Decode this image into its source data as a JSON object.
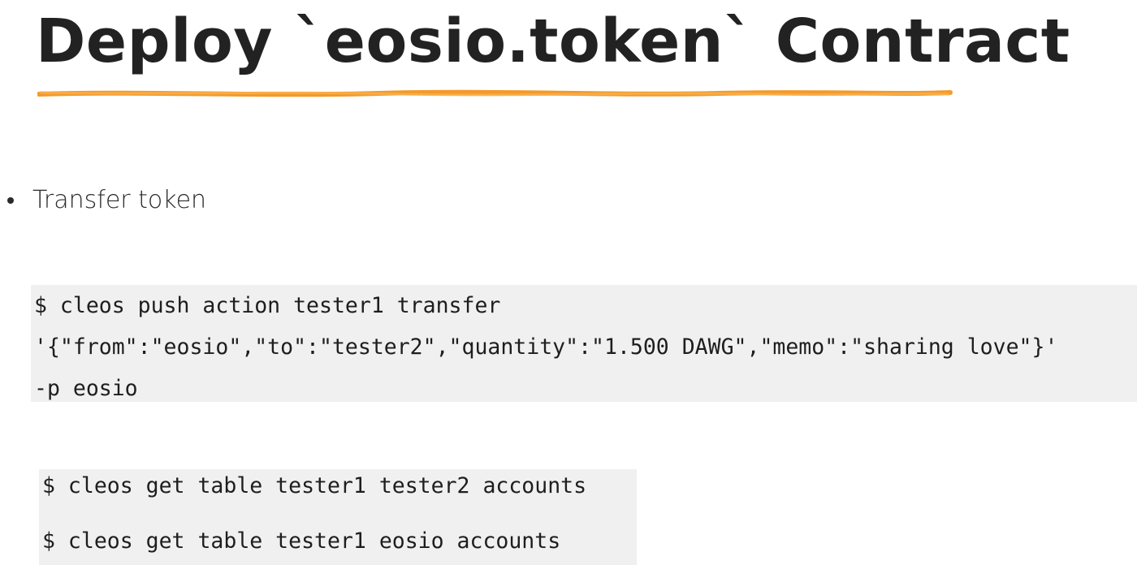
{
  "slide": {
    "title": "Deploy `eosio.token` Contract",
    "accent_color": "#f39a2b",
    "bullets": [
      {
        "text": "Transfer token"
      }
    ],
    "code_blocks": [
      {
        "lines": [
          "$ cleos push action tester1 transfer",
          "'{\"from\":\"eosio\",\"to\":\"tester2\",\"quantity\":\"1.500 DAWG\",\"memo\":\"sharing love\"}'",
          "-p eosio"
        ]
      },
      {
        "lines": [
          "$ cleos get table tester1 tester2 accounts",
          "$ cleos get table tester1 eosio accounts"
        ]
      }
    ]
  }
}
